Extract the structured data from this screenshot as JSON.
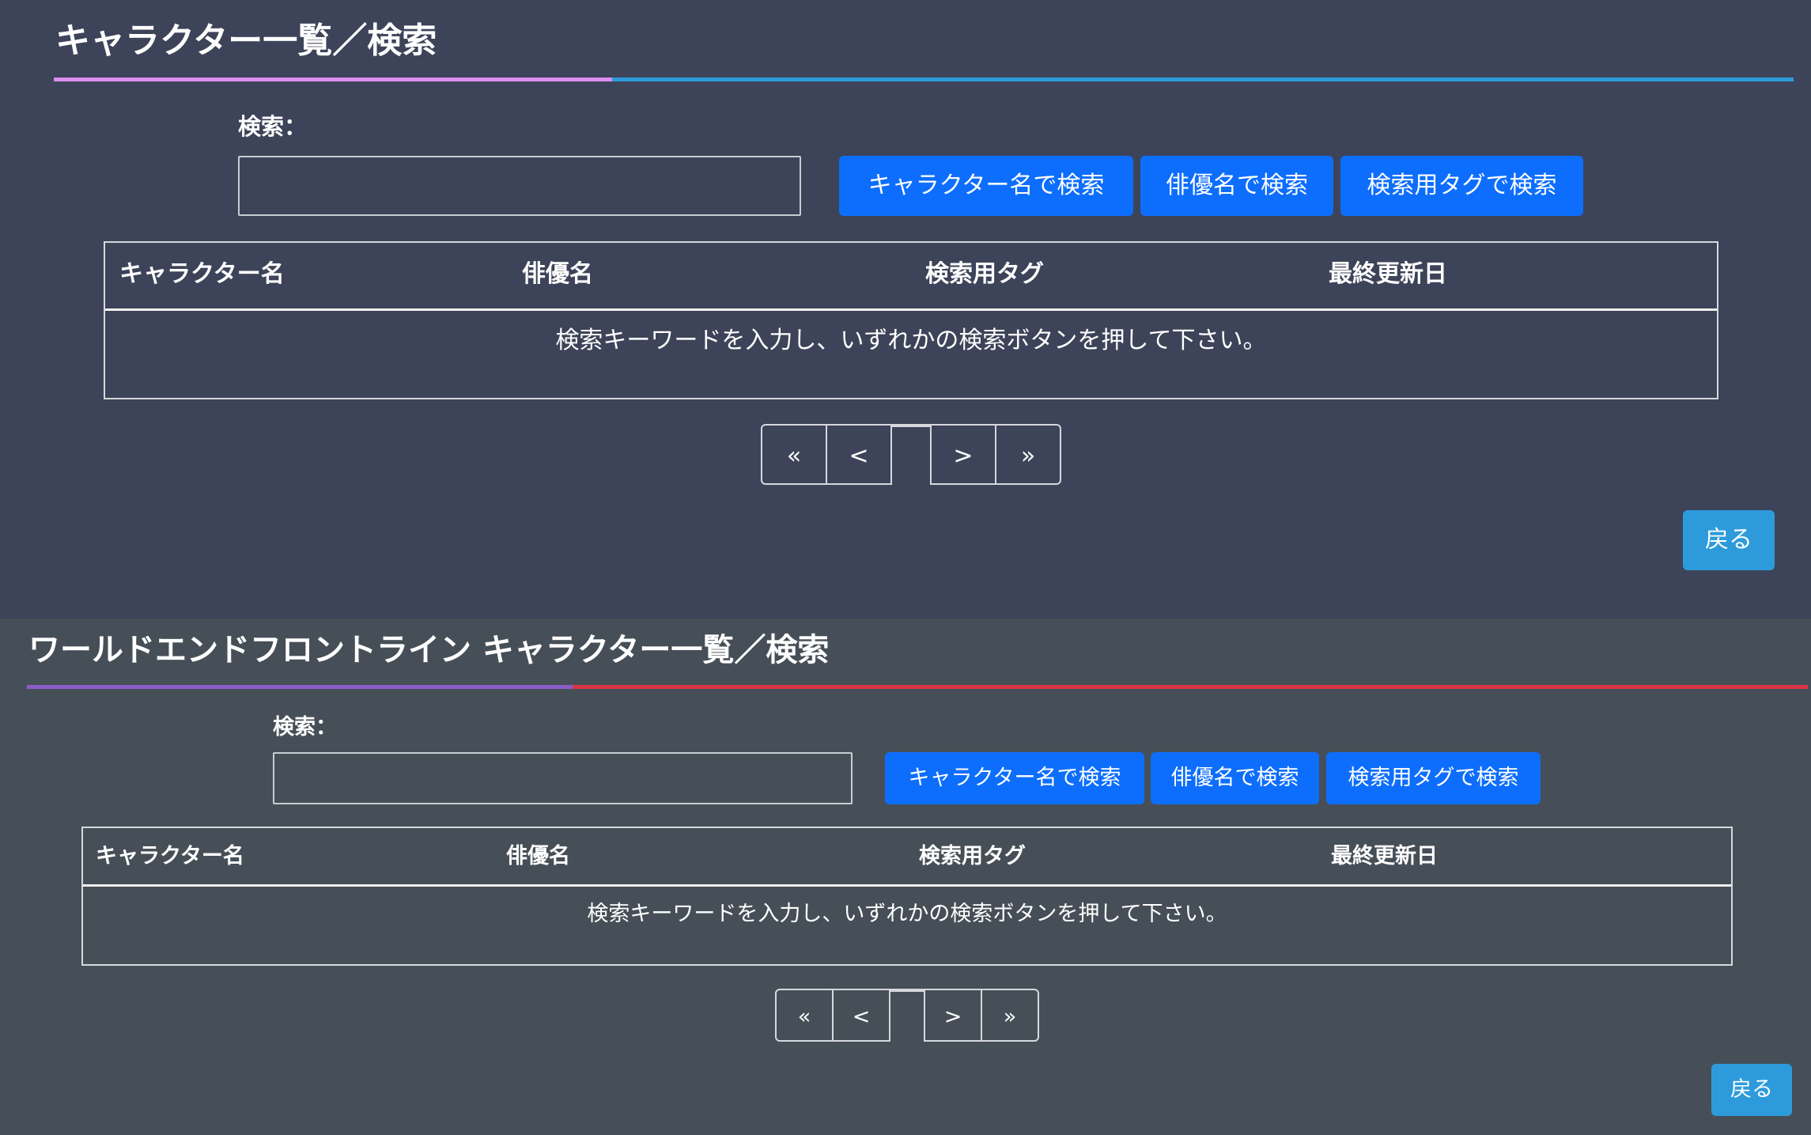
{
  "panels": [
    {
      "title": "キャラクター一覧／検索",
      "accent_color": "#d98ef0",
      "line_color": "#2d9bdb",
      "search": {
        "label": "検索：",
        "value": "",
        "placeholder": ""
      },
      "buttons": {
        "by_character": "キャラクター名で検索",
        "by_actor": "俳優名で検索",
        "by_tag": "検索用タグで検索"
      },
      "table": {
        "columns": [
          "キャラクター名",
          "俳優名",
          "検索用タグ",
          "最終更新日"
        ],
        "empty_message": "検索キーワードを入力し、いずれかの検索ボタンを押して下さい。"
      },
      "pager": {
        "first": "«",
        "prev": "<",
        "next": ">",
        "last": "»"
      },
      "back_label": "戻る"
    },
    {
      "title": "ワールドエンドフロントライン キャラクター一覧／検索",
      "accent_color": "#8a5cc8",
      "line_color": "#dc3545",
      "search": {
        "label": "検索：",
        "value": "",
        "placeholder": ""
      },
      "buttons": {
        "by_character": "キャラクター名で検索",
        "by_actor": "俳優名で検索",
        "by_tag": "検索用タグで検索"
      },
      "table": {
        "columns": [
          "キャラクター名",
          "俳優名",
          "検索用タグ",
          "最終更新日"
        ],
        "empty_message": "検索キーワードを入力し、いずれかの検索ボタンを押して下さい。"
      },
      "pager": {
        "first": "«",
        "prev": "<",
        "next": ">",
        "last": "»"
      },
      "back_label": "戻る"
    }
  ]
}
